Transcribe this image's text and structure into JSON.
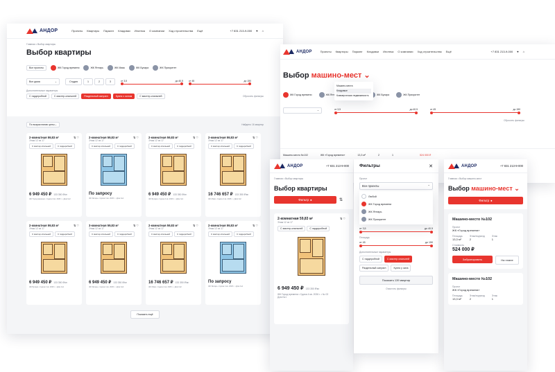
{
  "brand": {
    "name": "АНДОР",
    "phone": "+7 831 213-9-000"
  },
  "desktop": {
    "nav": [
      "Проекты",
      "Квартиры",
      "Паркинг",
      "Кладовки",
      "Ипотека",
      "О компании",
      "Ход строительства",
      "Ещё"
    ],
    "breadcrumb": "Главная • Выбор квартиры",
    "title": "Выбор квартиры",
    "projects": [
      "Все проекты",
      "ЖК Город времени",
      "ЖК Янтарь",
      "ЖК Маяк",
      "ЖК Бухара",
      "ЖК Приоритет"
    ],
    "filters": {
      "project_value": "Все дома",
      "rooms": [
        "Студия",
        "1",
        "2",
        "3"
      ],
      "area_from": "от 3,5",
      "area_to": "до 40,5",
      "price_from": "от 45",
      "price_to": "до 150"
    },
    "extra_label": "Дополнительные параметры",
    "extra": [
      "С гардеробной",
      "С мастер-спальней",
      "Раздельный санузел",
      "Кухня с окном",
      "С мастер-спальней"
    ],
    "reset": "Сбросить фильтры",
    "sort": "По возрастанию цены",
    "found": "Найдено 16 квартир",
    "cards": [
      {
        "title": "2-комнатная 59,83 м²",
        "sub": "Этаж 12 из 17",
        "tags": [
          "С мастер-спальней",
          "С гардеробной"
        ],
        "price": "6 949 450 ₽",
        "ppm": "133 350 ₽/м²",
        "plan": "orange",
        "meta": "ЖК Город времени • Сдача 4 кв. 2026 г. • Дом №2"
      },
      {
        "title": "2-комнатная 59,83 м²",
        "sub": "Этаж 12 из 17",
        "tags": [
          "С мастер-спальней",
          "С гардеробной"
        ],
        "price": "По запросу",
        "ppm": "",
        "plan": "blue",
        "meta": "ЖК Янтарь • Сдача 4 кв. 2026 г. • Дом №1"
      },
      {
        "title": "2-комнатная 59,83 м²",
        "sub": "Этаж 12 из 17",
        "tags": [
          "С мастер-спальней",
          "С гардеробной"
        ],
        "price": "6 949 450 ₽",
        "ppm": "133 350 ₽/м²",
        "plan": "orange",
        "meta": "ЖК Бухара • Сдача 4 кв. 2026 г. • Дом №1"
      },
      {
        "title": "2-комнатная 59,83 м²",
        "sub": "Этаж 12 из 17",
        "tags": [
          "С мастер-спальней",
          "С гардеробной"
        ],
        "price": "16 746 657 ₽",
        "ppm": "133 350 ₽/м²",
        "plan": "orange",
        "meta": "ЖК Маяк • Сдача 4 кв. 2026 г. • Дом №2"
      },
      {
        "title": "2-комнатная 59,83 м²",
        "sub": "Этаж 12 из 17",
        "tags": [
          "С мастер-спальней",
          "С гардеробной"
        ],
        "price": "6 949 450 ₽",
        "ppm": "133 350 ₽/м²",
        "plan": "orange",
        "meta": "ЖК Бухара • Сдача 4 кв. 2026 г. • Дом №1"
      },
      {
        "title": "3-комнатная 59,83 м²",
        "sub": "Этаж 12 из 17",
        "tags": [
          "С мастер-спальней",
          "С гардеробной"
        ],
        "price": "6 949 450 ₽",
        "ppm": "133 350 ₽/м²",
        "plan": "orange",
        "meta": "ЖК Янтарь • Сдача 4 кв. 2026 г. • Дом №2"
      },
      {
        "title": "2-комнатная 59,83 м²",
        "sub": "Этаж 12 из 17",
        "tags": [
          "С мастер-спальней",
          "С гардеробной"
        ],
        "price": "16 746 657 ₽",
        "ppm": "133 350 ₽/м²",
        "plan": "orange",
        "meta": "ЖК Маяк • Сдача 4 кв. 2026 г. • Дом №2"
      },
      {
        "title": "2-комнатная 59,83 м²",
        "sub": "Этаж 12 из 17",
        "tags": [
          "С мастер-спальней",
          "С гардеробной"
        ],
        "price": "По запросу",
        "ppm": "",
        "plan": "blue",
        "meta": "ЖК Янтарь • Сдача 4 кв. 2026 г. • Дом №1"
      }
    ],
    "show_more": "Показать ещё"
  },
  "parking": {
    "title_a": "Выбор",
    "title_b": "машино-мест",
    "dropdown": [
      "Машино-места",
      "Кладовые",
      "Коммерческая недвижимость"
    ],
    "projects": [
      "Все проекты",
      "ЖК Город времени",
      "ЖК Янтарь",
      "ЖК Маяк",
      "ЖК Бухара",
      "ЖК Приоритет"
    ],
    "slider_a_from": "от 3,5",
    "slider_a_to": "до 40,5",
    "slider_b_from": "от 45",
    "slider_b_to": "до 150",
    "reset": "Сбросить фильтры",
    "row": {
      "name": "Машино-место №102",
      "project": "ЖК «Город времени»",
      "area": "13,3 м²",
      "floor": "2",
      "level": "1",
      "price": "524 000 ₽"
    }
  },
  "mobile": {
    "breadcrumb": "Главная • Выбор квартиры",
    "title": "Выбор квартиры",
    "filter_btn": "Фильтр",
    "card": {
      "title": "2-комнатная 59,83 м²",
      "sub": "Этаж 12 из 17",
      "tags": [
        "С мастер-спальней",
        "С гардеробной"
      ],
      "price": "6 949 450 ₽",
      "ppm": "133 350 ₽/м²",
      "meta": "ЖК Город времени • Сдача 4 кв. 2026 г. • № 02",
      "meta2": "Дом №1"
    },
    "filters": {
      "title": "Фильтры",
      "project_label": "Проект",
      "select_value": "Все проекты",
      "options": [
        "Любой",
        "ЖК Город времени",
        "ЖК Янтарь",
        "ЖК Приоритет"
      ],
      "area_from": "от 3,5",
      "area_to": "до 40,5",
      "area_label": "Площадь",
      "price_from": "от 45",
      "price_to": "до 150",
      "extra_label": "Дополнительные параметры",
      "extra": [
        "С гардеробной",
        "С мастер спальней",
        "Раздельный санузел",
        "Кухня у окна"
      ],
      "show": "Показать 139 квартир",
      "reset": "Очистить фильтры"
    },
    "parking": {
      "breadcrumb": "Главная • Выбор машино-мест",
      "title_a": "Выбор",
      "title_b": "машино-мест",
      "filter_btn": "Фильтр",
      "card1": {
        "title": "Машино-место №102",
        "project_label": "Проект",
        "project": "ЖК «Город времени»",
        "area_label": "Площадь",
        "area": "13,3 м²",
        "floor_label": "Этаж/подъезд",
        "floor": "2",
        "level_label": "Этаж",
        "level": "1",
        "cost_label": "Стоимость",
        "price": "524 000 ₽",
        "book": "Забронировать",
        "plan": "На плане"
      },
      "card2": {
        "title": "Машино-место №102",
        "project_label": "Проект",
        "project": "ЖК «Город времени»",
        "area_label": "Площадь",
        "area": "13,3 м²",
        "floor_label": "Этаж/подъезд",
        "floor": "2",
        "level_label": "Этаж",
        "level": "1"
      }
    }
  },
  "colors": {
    "accent": "#e8352e",
    "navy": "#1d2b64",
    "bg": "#f4f5f7"
  }
}
